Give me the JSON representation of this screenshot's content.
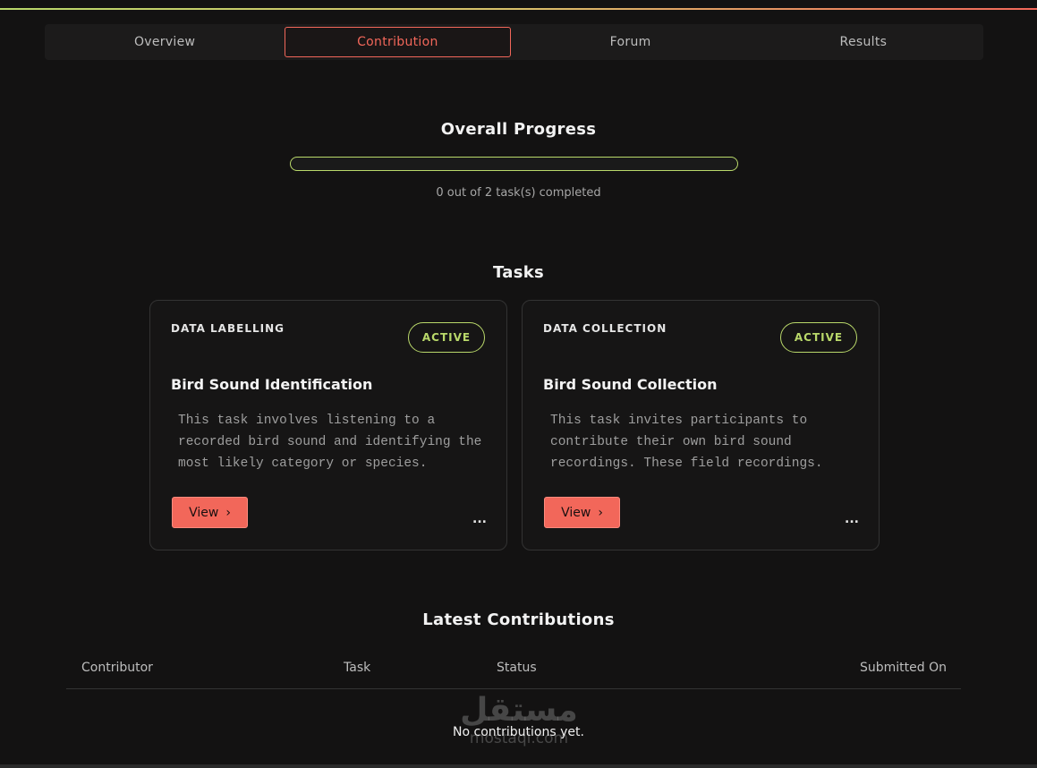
{
  "tabs": [
    {
      "label": "Overview",
      "active": false
    },
    {
      "label": "Contribution",
      "active": true
    },
    {
      "label": "Forum",
      "active": false
    },
    {
      "label": "Results",
      "active": false
    }
  ],
  "progress": {
    "title": "Overall Progress",
    "completed": 0,
    "total": 2,
    "fraction": 0,
    "text": "0 out of 2 task(s) completed"
  },
  "tasks_section": {
    "title": "Tasks",
    "cards": [
      {
        "type": "DATA LABELLING",
        "status": "ACTIVE",
        "title": "Bird Sound Identification",
        "description": "This task involves listening to a recorded bird sound and identifying the most likely category or species.",
        "view_label": "View",
        "more_label": "..."
      },
      {
        "type": "DATA COLLECTION",
        "status": "ACTIVE",
        "title": "Bird Sound Collection",
        "description": "This task invites participants to contribute their own bird sound recordings. These field recordings.",
        "view_label": "View",
        "more_label": "..."
      }
    ]
  },
  "contributions": {
    "title": "Latest Contributions",
    "columns": [
      "Contributor",
      "Task",
      "Status",
      "Submitted On"
    ],
    "empty_text": "No contributions yet."
  },
  "watermark": {
    "arabic": "مستقل",
    "latin": "mostaql.com"
  },
  "colors": {
    "accent": "#f2675a",
    "active": "#b9d86a",
    "background": "#131212"
  }
}
